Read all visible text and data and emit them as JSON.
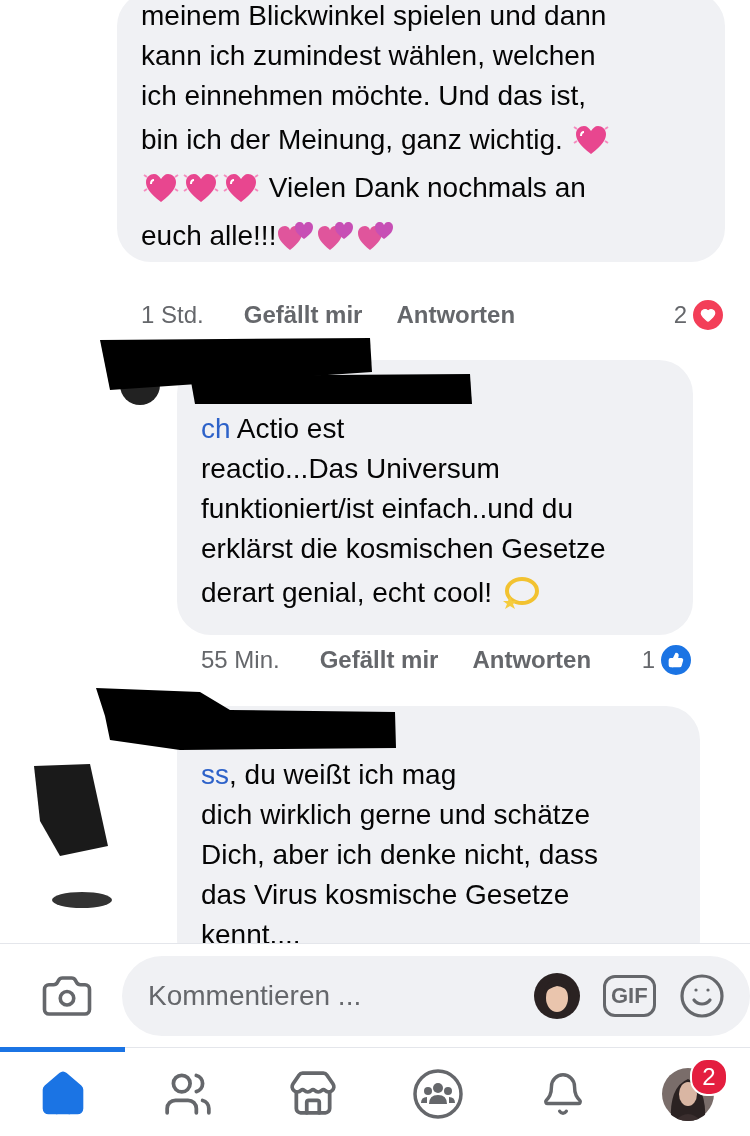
{
  "comments": [
    {
      "redacted": false,
      "lines": [
        [
          {
            "kind": "text",
            "text": "meinem Blickwinkel spielen und dann"
          }
        ],
        [
          {
            "kind": "text",
            "text": "kann ich zumindest wählen, welchen"
          }
        ],
        [
          {
            "kind": "text",
            "text": "ich einnehmen möchte. Und das ist,"
          }
        ],
        [
          {
            "kind": "text",
            "text": "bin ich der Meinung, ganz wichtig. "
          },
          {
            "kind": "sparkle-heart"
          }
        ],
        [
          {
            "kind": "sparkle-heart"
          },
          {
            "kind": "sparkle-heart"
          },
          {
            "kind": "sparkle-heart"
          },
          {
            "kind": "text",
            "text": " Vielen Dank nochmals an"
          }
        ],
        [
          {
            "kind": "text",
            "text": "euch alle!!!"
          },
          {
            "kind": "two-hearts"
          },
          {
            "kind": "two-hearts"
          },
          {
            "kind": "two-hearts"
          }
        ]
      ],
      "meta": {
        "time": "1 Std.",
        "like": "Gefällt mir",
        "reply": "Antworten",
        "reaction": {
          "count": "2",
          "kind": "love"
        }
      }
    },
    {
      "redacted": true,
      "lines": [
        [
          {
            "kind": "mention",
            "text": "ch"
          },
          {
            "kind": "text",
            "text": " Actio est"
          }
        ],
        [
          {
            "kind": "text",
            "text": "reactio...Das Universum"
          }
        ],
        [
          {
            "kind": "text",
            "text": "funktioniert/ist einfach..und du"
          }
        ],
        [
          {
            "kind": "text",
            "text": "erklärst die kosmischen Gesetze"
          }
        ],
        [
          {
            "kind": "text",
            "text": "derart genial, echt cool! "
          },
          {
            "kind": "dizzy"
          }
        ]
      ],
      "meta": {
        "time": "55 Min.",
        "like": "Gefällt mir",
        "reply": "Antworten",
        "reaction": {
          "count": "1",
          "kind": "like"
        }
      }
    },
    {
      "redacted": true,
      "lines": [
        [
          {
            "kind": "mention",
            "text": "ss"
          },
          {
            "kind": "text",
            "text": ", du weißt ich mag"
          }
        ],
        [
          {
            "kind": "text",
            "text": "dich wirklich gerne und schätze"
          }
        ],
        [
          {
            "kind": "text",
            "text": "Dich, aber ich denke nicht, dass"
          }
        ],
        [
          {
            "kind": "text",
            "text": "das Virus kosmische Gesetze"
          }
        ],
        [
          {
            "kind": "text",
            "text": "kennt...."
          }
        ]
      ]
    }
  ],
  "composer": {
    "placeholder": "Kommentieren ...",
    "gif_label": "GIF"
  },
  "tabs": [
    {
      "kind": "home",
      "selected": true
    },
    {
      "kind": "friends",
      "selected": false
    },
    {
      "kind": "marketplace",
      "selected": false
    },
    {
      "kind": "groups",
      "selected": false
    },
    {
      "kind": "notifications",
      "selected": false
    },
    {
      "kind": "menu",
      "selected": false,
      "badge": "2"
    }
  ]
}
